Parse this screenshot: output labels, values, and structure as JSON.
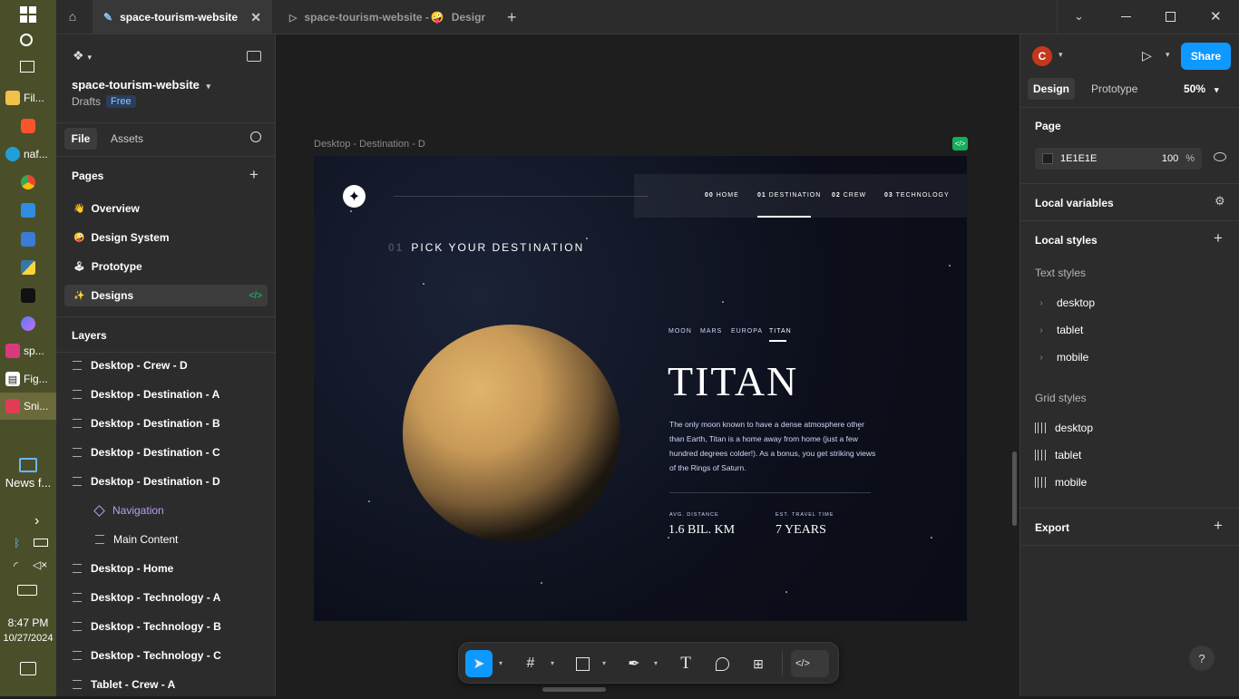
{
  "taskbar": {
    "items": [
      {
        "label": "Fil..."
      },
      {
        "label": "naf..."
      },
      {
        "label": "sp..."
      },
      {
        "label": "Fig..."
      },
      {
        "label": "Sni..."
      }
    ],
    "news_label": "News f...",
    "time": "8:47 PM",
    "date": "10/27/2024"
  },
  "tabs": {
    "active": "space-tourism-website",
    "second": "space-tourism-website - ",
    "second_suffix": "Design S"
  },
  "left": {
    "file_name": "space-tourism-website",
    "drafts": "Drafts",
    "plan_badge": "Free",
    "tab_file": "File",
    "tab_assets": "Assets",
    "pages_heading": "Pages",
    "pages": [
      {
        "label": "Overview",
        "emoji": "👋"
      },
      {
        "label": "Design System",
        "emoji": "🤪"
      },
      {
        "label": "Prototype",
        "emoji": "🕹"
      },
      {
        "label": "Designs",
        "emoji": "✨"
      }
    ],
    "layers_heading": "Layers",
    "layers": [
      {
        "label": "Desktop - Crew - D"
      },
      {
        "label": "Desktop - Destination - A"
      },
      {
        "label": "Desktop - Destination - B"
      },
      {
        "label": "Desktop - Destination - C"
      },
      {
        "label": "Desktop - Destination - D"
      },
      {
        "label": "Navigation"
      },
      {
        "label": "Main Content"
      },
      {
        "label": "Desktop - Home"
      },
      {
        "label": "Desktop - Technology - A"
      },
      {
        "label": "Desktop - Technology - B"
      },
      {
        "label": "Desktop - Technology - C"
      },
      {
        "label": "Tablet - Crew - A"
      }
    ]
  },
  "canvas": {
    "frame_label": "Desktop - Destination - D",
    "nav": [
      {
        "num": "00",
        "label": "HOME"
      },
      {
        "num": "01",
        "label": "DESTINATION"
      },
      {
        "num": "02",
        "label": "CREW"
      },
      {
        "num": "03",
        "label": "TECHNOLOGY"
      }
    ],
    "heading_num": "01",
    "heading": "PICK YOUR DESTINATION",
    "dest_tabs": [
      "MOON",
      "MARS",
      "EUROPA",
      "TITAN"
    ],
    "title": "TITAN",
    "description": "The only moon known to have a dense atmosphere other than Earth, Titan is a home away from home (just a few hundred degrees colder!). As a bonus, you get striking views of the Rings of Saturn.",
    "stat1_label": "AVG. DISTANCE",
    "stat1_value": "1.6 BIL. KM",
    "stat2_label": "EST. TRAVEL TIME",
    "stat2_value": "7 YEARS"
  },
  "right": {
    "avatar_letter": "C",
    "share": "Share",
    "tab_design": "Design",
    "tab_prototype": "Prototype",
    "zoom": "50%",
    "page_heading": "Page",
    "page_color": "1E1E1E",
    "page_opacity": "100",
    "percent": "%",
    "local_variables": "Local variables",
    "local_styles": "Local styles",
    "text_styles": "Text styles",
    "text_style_items": [
      "desktop",
      "tablet",
      "mobile"
    ],
    "grid_styles": "Grid styles",
    "grid_style_items": [
      "desktop",
      "tablet",
      "mobile"
    ],
    "export": "Export"
  },
  "colors": {
    "accent": "#0d99ff",
    "avatar": "#c4381d",
    "component": "#b89cf5",
    "dev_mode": "#14ae5c"
  }
}
